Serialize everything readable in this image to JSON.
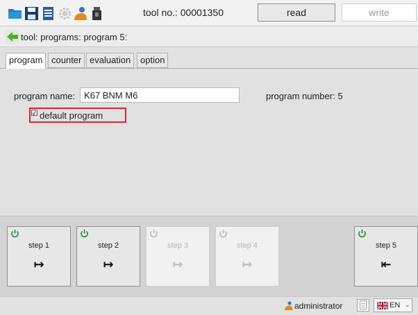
{
  "toolbar": {
    "tool_no": "tool no.: 00001350",
    "read_label": "read",
    "write_label": "write",
    "icons": [
      "folder-open-icon",
      "save-icon",
      "print-icon",
      "settings-gear-icon",
      "user-icon",
      "usb-stick-icon"
    ]
  },
  "breadcrumb": {
    "text": "tool: programs: program 5:"
  },
  "tabs": [
    {
      "label": "program",
      "active": true
    },
    {
      "label": "counter",
      "active": false
    },
    {
      "label": "evaluation",
      "active": false
    },
    {
      "label": "option",
      "active": false
    }
  ],
  "program": {
    "name_label": "program name:",
    "name_value": "K67 BNM M6",
    "number_label": "program number: 5",
    "default_label": "default program",
    "default_checked": true
  },
  "steps": [
    {
      "label": "step 1",
      "arrow": "↦",
      "enabled": true
    },
    {
      "label": "step 2",
      "arrow": "↦",
      "enabled": true
    },
    {
      "label": "step 3",
      "arrow": "↦",
      "enabled": false
    },
    {
      "label": "step 4",
      "arrow": "↦",
      "enabled": false
    },
    {
      "label": "step 5",
      "arrow": "⇤",
      "enabled": true
    }
  ],
  "status": {
    "user": "administrator",
    "language": "EN"
  },
  "colors": {
    "highlight": "#d9262c",
    "power_on": "#2e9b3c",
    "power_off": "#bdbdbd",
    "folder": "#1f7fbf",
    "back_arrow": "#4caf2a"
  }
}
